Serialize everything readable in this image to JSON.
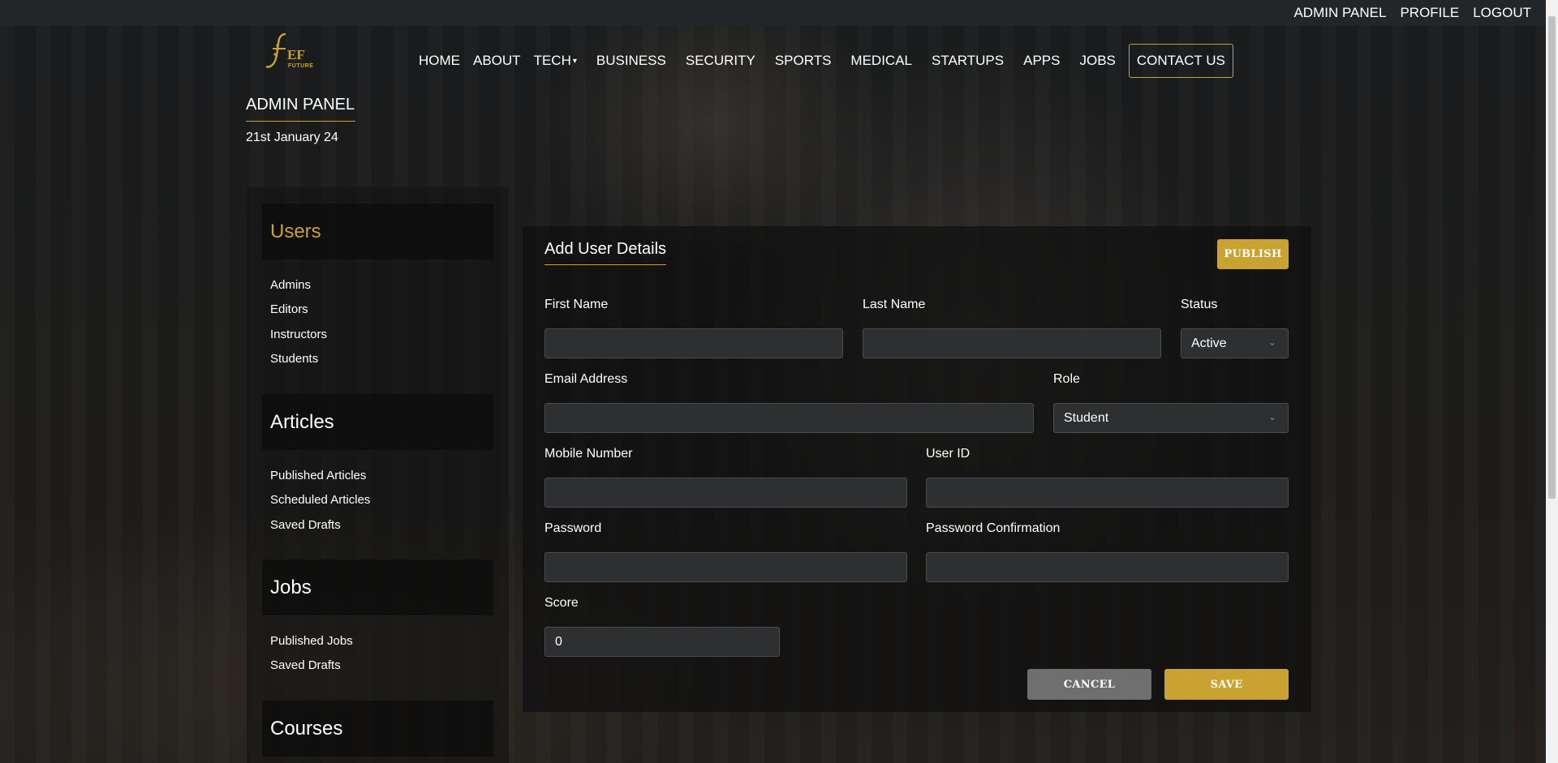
{
  "topbar": {
    "links": [
      "ADMIN PANEL",
      "PROFILE",
      "LOGOUT"
    ]
  },
  "logo": {
    "letters": "EF",
    "sub": "FUTURE",
    "initial": "f"
  },
  "nav": {
    "items": [
      "HOME",
      "ABOUT",
      "TECH",
      "BUSINESS",
      "SECURITY",
      "SPORTS",
      "MEDICAL",
      "STARTUPS",
      "APPS",
      "JOBS"
    ],
    "contact": "CONTACT US",
    "tech_caret": "▾"
  },
  "header": {
    "title": "ADMIN PANEL",
    "date": "21st January 24"
  },
  "sidebar": {
    "users": {
      "title": "Users",
      "links": [
        "Admins",
        "Editors",
        "Instructors",
        "Students"
      ]
    },
    "articles": {
      "title": "Articles",
      "links": [
        "Published Articles",
        "Scheduled Articles",
        "Saved Drafts"
      ]
    },
    "jobs": {
      "title": "Jobs",
      "links": [
        "Published Jobs",
        "Saved Drafts"
      ]
    },
    "courses": {
      "title": "Courses"
    }
  },
  "form": {
    "title": "Add User Details",
    "publish": "PUBLISH",
    "first_name_label": "First Name",
    "last_name_label": "Last Name",
    "status_label": "Status",
    "status_value": "Active",
    "email_label": "Email Address",
    "role_label": "Role",
    "role_value": "Student",
    "mobile_label": "Mobile Number",
    "userid_label": "User ID",
    "password_label": "Password",
    "password_confirm_label": "Password Confirmation",
    "score_label": "Score",
    "score_value": "0",
    "cancel": "CANCEL",
    "save": "SAVE"
  },
  "colors": {
    "accent": "#c9a232",
    "panel": "#141414",
    "field": "#2d2f31"
  }
}
